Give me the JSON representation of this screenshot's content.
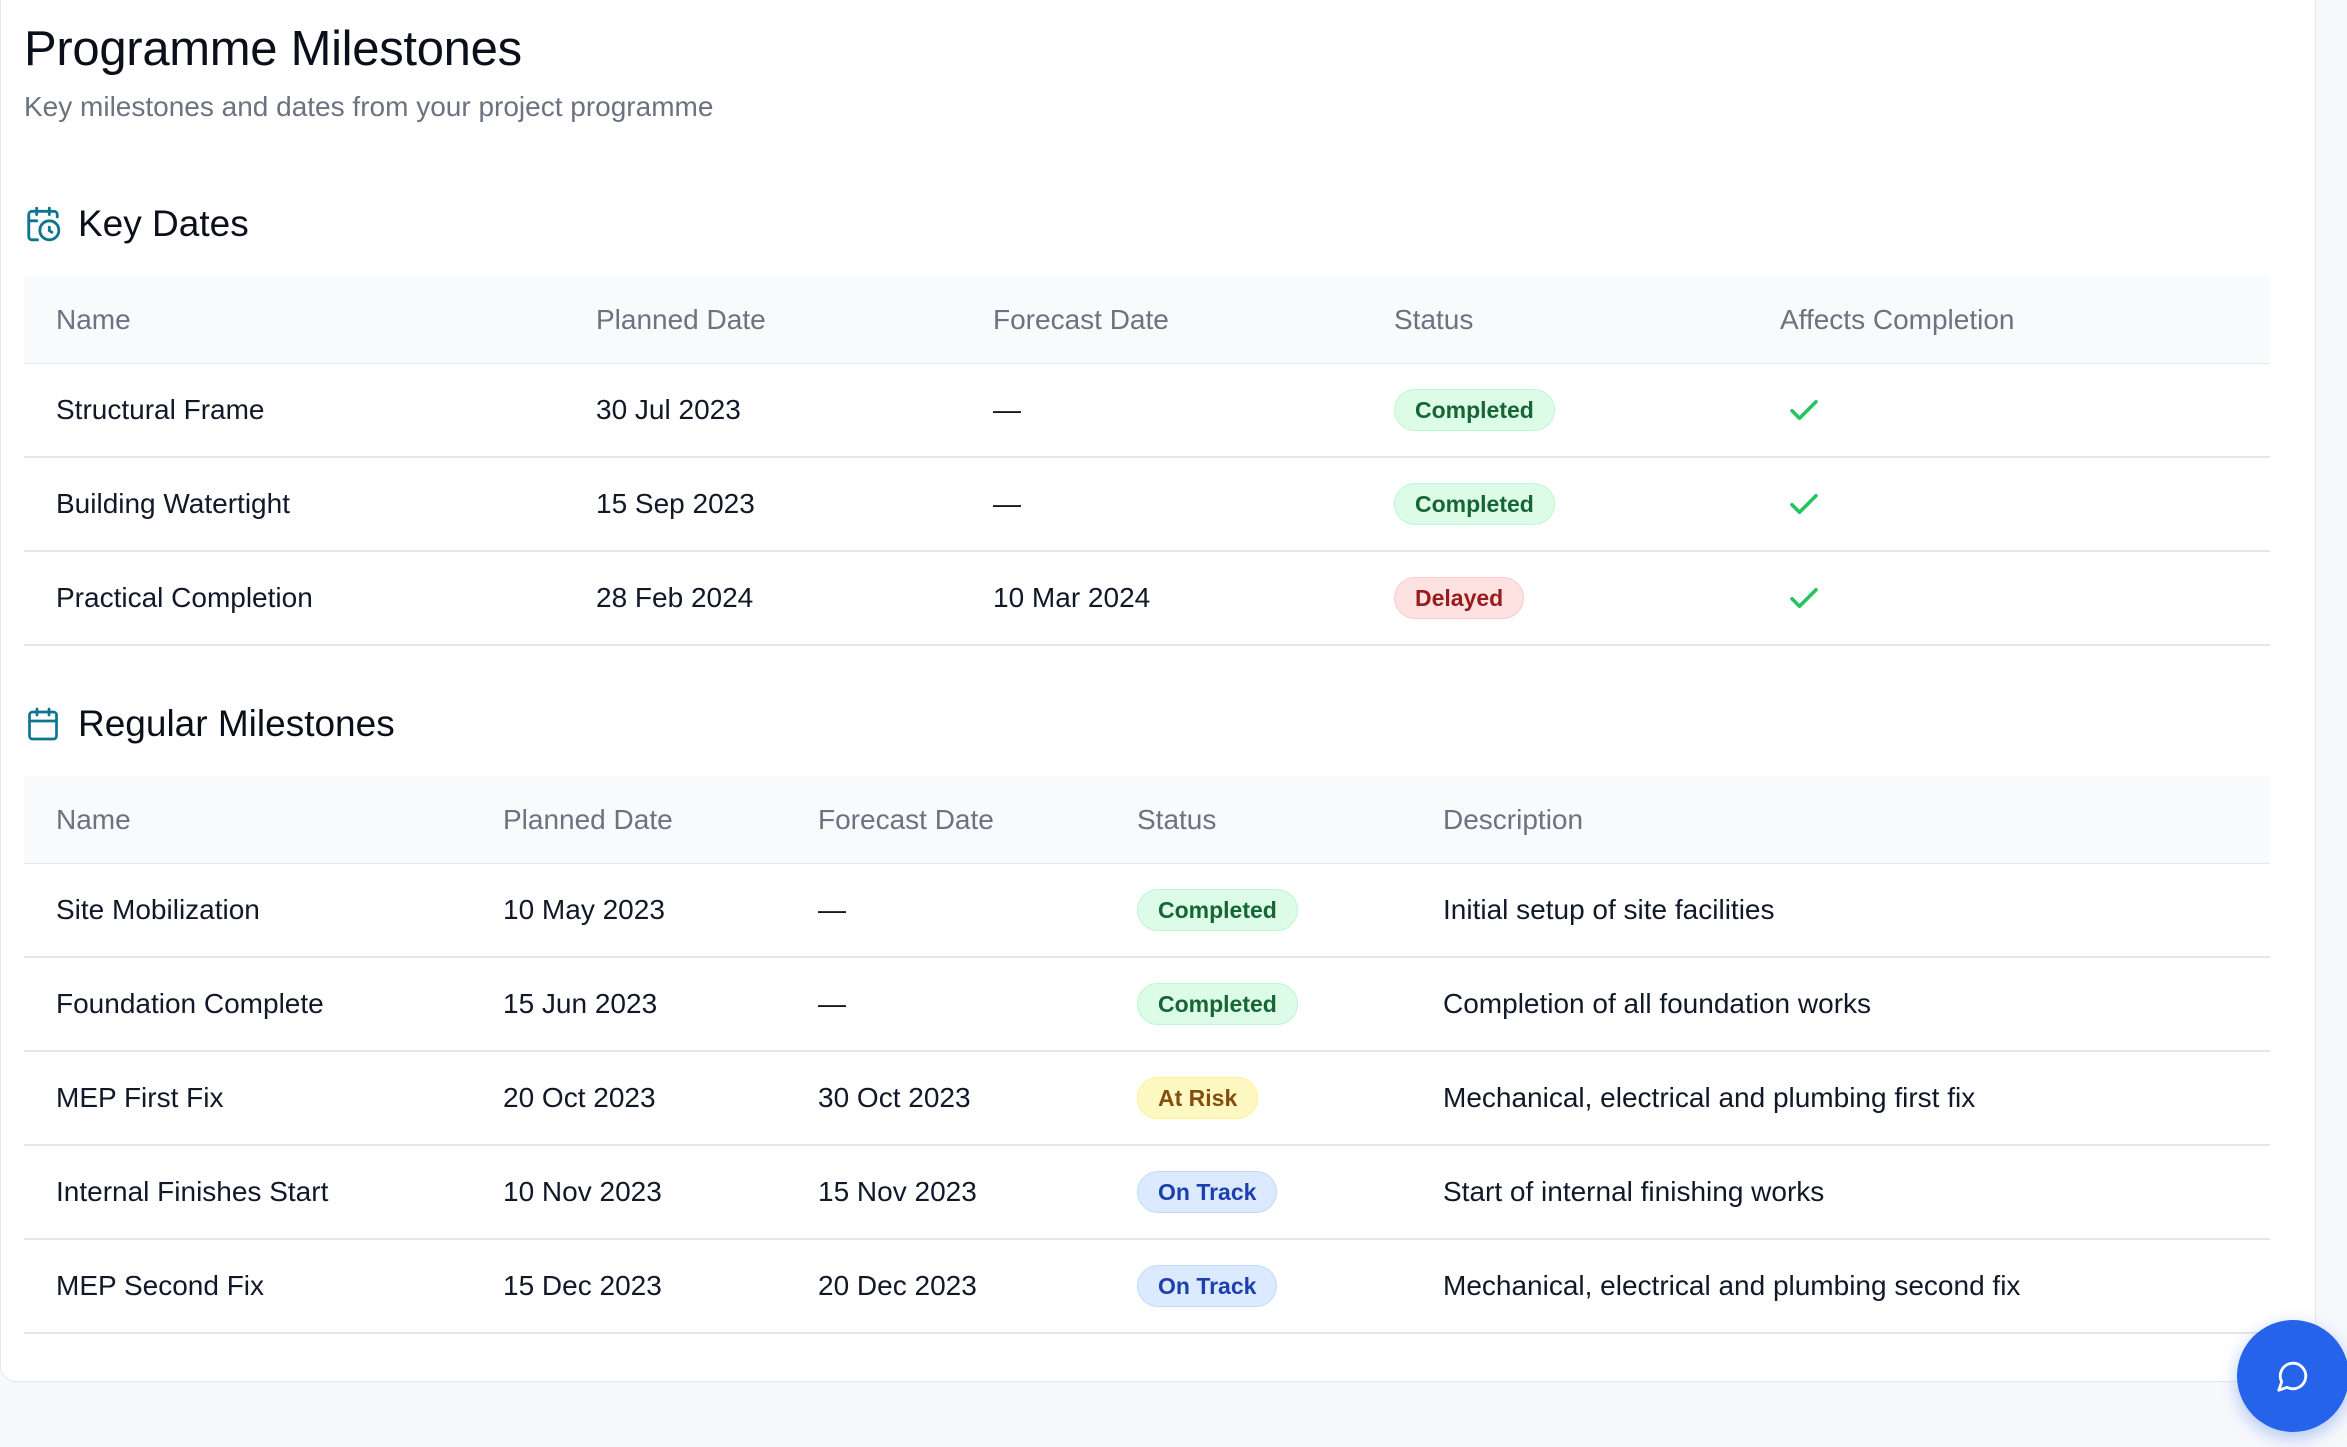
{
  "page": {
    "title": "Programme Milestones",
    "subtitle": "Key milestones and dates from your project programme"
  },
  "key_dates": {
    "title": "Key Dates",
    "icon": "calendar-clock-icon",
    "columns": {
      "name": "Name",
      "planned": "Planned Date",
      "forecast": "Forecast Date",
      "status": "Status",
      "affects": "Affects Completion"
    },
    "rows": [
      {
        "name": "Structural Frame",
        "planned": "30 Jul 2023",
        "forecast": "—",
        "status": "Completed",
        "status_kind": "completed",
        "affects_completion": true
      },
      {
        "name": "Building Watertight",
        "planned": "15 Sep 2023",
        "forecast": "—",
        "status": "Completed",
        "status_kind": "completed",
        "affects_completion": true
      },
      {
        "name": "Practical Completion",
        "planned": "28 Feb 2024",
        "forecast": "10 Mar 2024",
        "status": "Delayed",
        "status_kind": "delayed",
        "affects_completion": true
      }
    ]
  },
  "regular_milestones": {
    "title": "Regular Milestones",
    "icon": "calendar-icon",
    "columns": {
      "name": "Name",
      "planned": "Planned Date",
      "forecast": "Forecast Date",
      "status": "Status",
      "description": "Description"
    },
    "rows": [
      {
        "name": "Site Mobilization",
        "planned": "10 May 2023",
        "forecast": "—",
        "status": "Completed",
        "status_kind": "completed",
        "description": "Initial setup of site facilities"
      },
      {
        "name": "Foundation Complete",
        "planned": "15 Jun 2023",
        "forecast": "—",
        "status": "Completed",
        "status_kind": "completed",
        "description": "Completion of all foundation works"
      },
      {
        "name": "MEP First Fix",
        "planned": "20 Oct 2023",
        "forecast": "30 Oct 2023",
        "status": "At Risk",
        "status_kind": "atrisk",
        "description": "Mechanical, electrical and plumbing first fix"
      },
      {
        "name": "Internal Finishes Start",
        "planned": "10 Nov 2023",
        "forecast": "15 Nov 2023",
        "status": "On Track",
        "status_kind": "ontrack",
        "description": "Start of internal finishing works"
      },
      {
        "name": "MEP Second Fix",
        "planned": "15 Dec 2023",
        "forecast": "20 Dec 2023",
        "status": "On Track",
        "status_kind": "ontrack",
        "description": "Mechanical, electrical and plumbing second fix"
      }
    ]
  },
  "chat_button": {
    "icon": "chat-bubble-icon"
  },
  "colors": {
    "accent": "#2563eb",
    "section_icon": "#0e7490",
    "check": "#22c55e"
  }
}
